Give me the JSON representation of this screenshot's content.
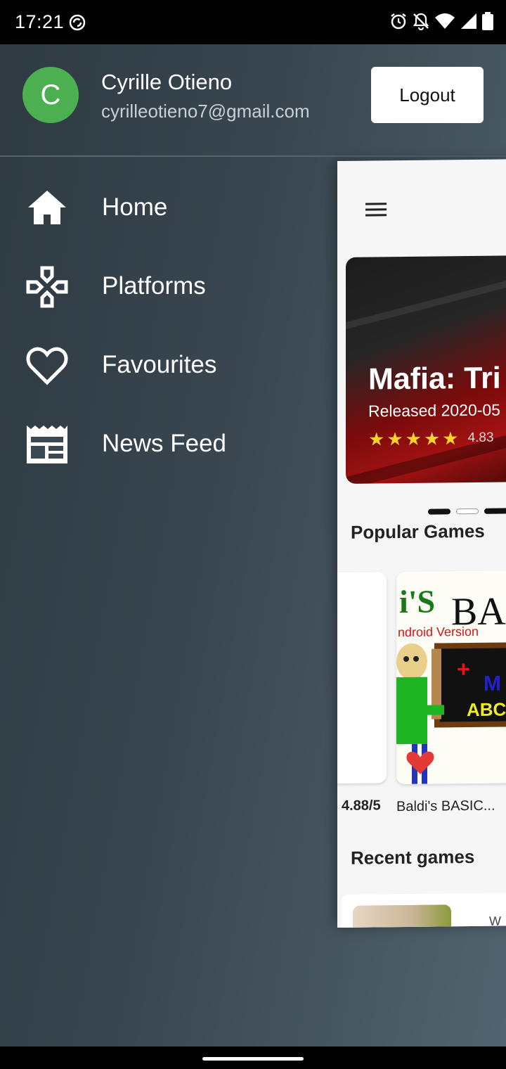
{
  "status_bar": {
    "time": "17:21",
    "icons": [
      "do-not-disturb-icon",
      "alarm-icon",
      "notifications-off-icon",
      "wifi-icon",
      "signal-icon",
      "battery-icon"
    ]
  },
  "drawer": {
    "avatar_letter": "C",
    "avatar_color": "#4caf50",
    "user_name": "Cyrille Otieno",
    "user_email": "cyrilleotieno7@gmail.com",
    "logout_label": "Logout",
    "nav_items": [
      {
        "label": "Home",
        "icon": "home-icon"
      },
      {
        "label": "Platforms",
        "icon": "gamepad-icon"
      },
      {
        "label": "Favourites",
        "icon": "heart-icon"
      },
      {
        "label": "News Feed",
        "icon": "newspaper-icon"
      }
    ]
  },
  "content": {
    "featured": {
      "title": "Mafia: Tri",
      "released": "Released 2020-05",
      "stars": 5,
      "rating": "4.83"
    },
    "popular_title": "Popular Games",
    "popular_games": [
      {
        "rating": "4.88/5"
      },
      {
        "name": "Baldi's BASIC...",
        "favourite": true
      }
    ],
    "recent_title": "Recent games",
    "recent_partial_text": "W"
  },
  "colors": {
    "accent_green": "#4caf50",
    "star_yellow": "#fdd22b",
    "heart_red": "#e53935"
  }
}
